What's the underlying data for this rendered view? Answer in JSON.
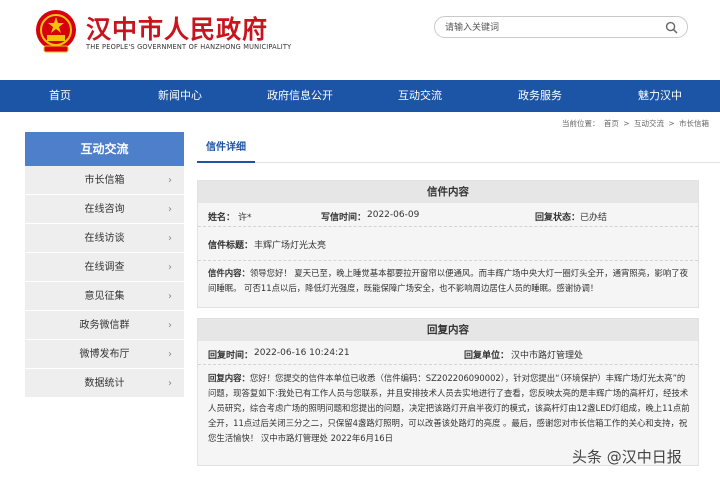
{
  "header": {
    "title": "汉中市人民政府",
    "subtitle": "THE PEOPLE'S GOVERNMENT OF HANZHONG MUNICIPALITY",
    "search_placeholder": "请输入关键词",
    "title_color": "#c8151d"
  },
  "nav": {
    "color": "#1d55a6",
    "items": [
      {
        "label": "首页"
      },
      {
        "label": "新闻中心"
      },
      {
        "label": "政府信息公开"
      },
      {
        "label": "互动交流"
      },
      {
        "label": "政务服务"
      },
      {
        "label": "魅力汉中"
      }
    ]
  },
  "breadcrumb": {
    "prefix": "当前位置：",
    "items": [
      "首页",
      "互动交流",
      "市长信箱"
    ],
    "separator": ">"
  },
  "sidebar": {
    "title": "互动交流",
    "items": [
      {
        "label": "市长信箱"
      },
      {
        "label": "在线咨询"
      },
      {
        "label": "在线访谈"
      },
      {
        "label": "在线调查"
      },
      {
        "label": "意见征集"
      },
      {
        "label": "政务微信群"
      },
      {
        "label": "微博发布厅"
      },
      {
        "label": "数据统计"
      }
    ]
  },
  "tab": {
    "label": "信件详细"
  },
  "letter": {
    "heading": "信件内容",
    "name_label": "姓名：",
    "name_value": "许*",
    "date_label": "写信时间：",
    "date_value": "2022-06-09",
    "status_label": "回复状态：",
    "status_value": "已办结",
    "subject_label": "信件标题：",
    "subject_value": "丰辉广场灯光太亮",
    "content_label": "信件内容：",
    "content_value": "领导您好！ 夏天已至，晚上睡觉基本都要拉开窗帘以便通风。而丰辉广场中央大灯一圈灯头全开，通宵照亮，影响了夜间睡眠。 可否11点以后，降低灯光强度，既能保障广场安全，也不影响周边居住人员的睡眠。感谢协调！"
  },
  "reply": {
    "heading": "回复内容",
    "time_label": "回复时间：",
    "time_value": "2022-06-16 10:24:21",
    "unit_label": "回复单位：",
    "unit_value": "汉中市路灯管理处",
    "content_label": "回复内容：",
    "content_value": "您好！您提交的信件本单位已收悉（信件编码：SZ202206090002），针对您提出“（环境保护）丰辉广场灯光太亮”的问题，现答复如下:我处已有工作人员与您联系，并且安排技术人员去实地进行了查看，您反映太亮的是丰辉广场的高杆灯，经技术人员研究，综合考虑广场的照明问题和您提出的问题，决定把该路灯开启半夜灯的模式，该高杆灯由12盏LED灯组成，晚上11点前全开，11点过后关闭三分之二，只保留4盏路灯照明，可以改善该处路灯的亮度 。最后，感谢您对市长信箱工作的关心和支持，祝您生活愉快！ 汉中市路灯管理处 2022年6月16日"
  },
  "watermark": {
    "text": "头条 @汉中日报"
  }
}
